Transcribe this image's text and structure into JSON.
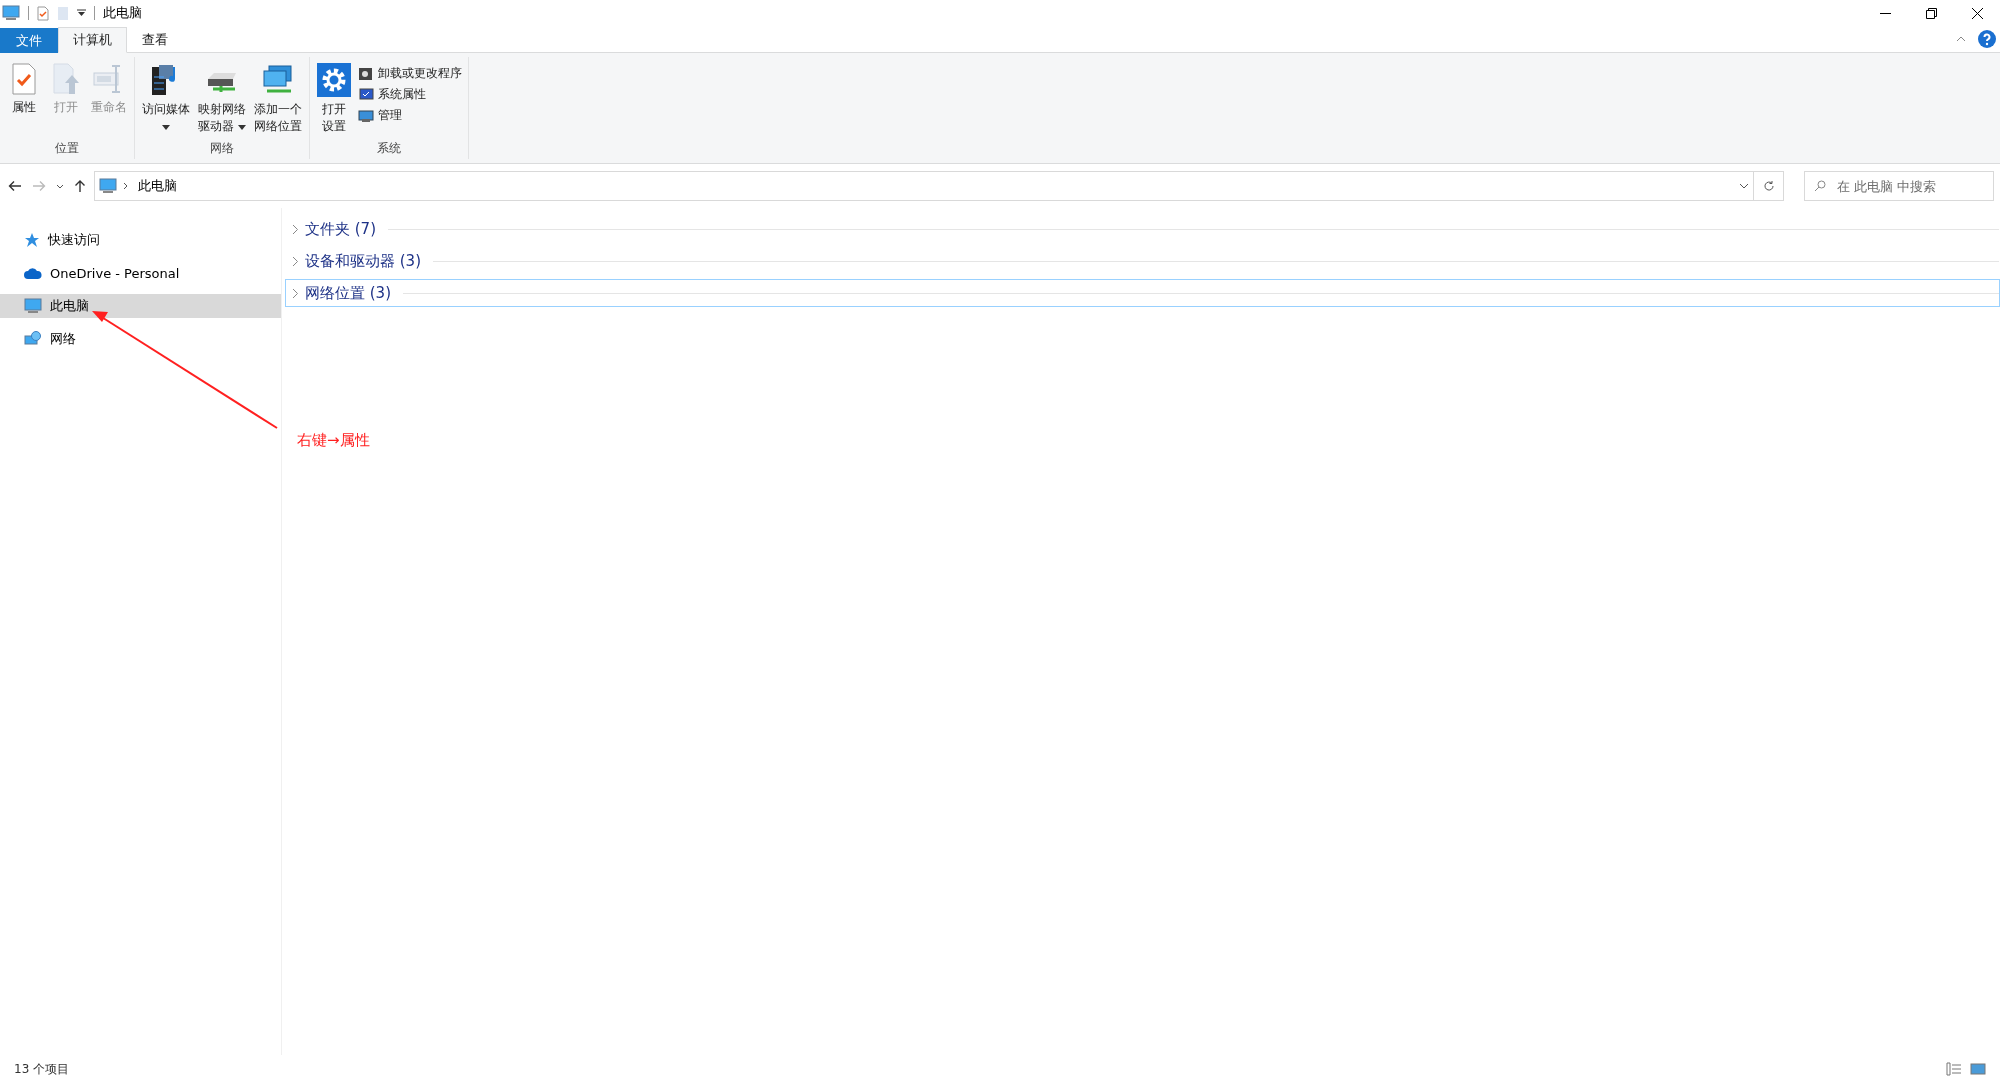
{
  "window": {
    "title": "此电脑"
  },
  "ribbon_tabs": [
    {
      "label": "文件",
      "kind": "file",
      "selected": false
    },
    {
      "label": "计算机",
      "kind": "tab",
      "selected": true
    },
    {
      "label": "查看",
      "kind": "tab",
      "selected": false
    }
  ],
  "ribbon_groups": [
    {
      "label": "位置",
      "buttons": [
        {
          "kind": "properties",
          "lines": [
            "属性"
          ],
          "disabled": false,
          "dropdown": false
        },
        {
          "kind": "open",
          "lines": [
            "打开"
          ],
          "disabled": true,
          "dropdown": false
        },
        {
          "kind": "rename",
          "lines": [
            "重命名"
          ],
          "disabled": true,
          "dropdown": false
        }
      ]
    },
    {
      "label": "网络",
      "buttons": [
        {
          "kind": "media",
          "lines": [
            "访问媒体"
          ],
          "disabled": false,
          "dropdown": true
        },
        {
          "kind": "drive",
          "lines": [
            "映射网络",
            "驱动器"
          ],
          "disabled": false,
          "dropdown": true
        },
        {
          "kind": "netloc",
          "lines": [
            "添加一个",
            "网络位置"
          ],
          "disabled": false,
          "dropdown": false
        }
      ]
    },
    {
      "label": "系统",
      "buttons": [
        {
          "kind": "settings",
          "lines": [
            "打开",
            "设置"
          ],
          "disabled": false,
          "dropdown": false
        }
      ],
      "small_buttons": [
        {
          "kind": "uninstall",
          "label": "卸载或更改程序"
        },
        {
          "kind": "sysprops",
          "label": "系统属性"
        },
        {
          "kind": "manage",
          "label": "管理"
        }
      ]
    }
  ],
  "address": {
    "path": "此电脑"
  },
  "search": {
    "placeholder": "在 此电脑 中搜索"
  },
  "sidebar": {
    "items": [
      {
        "kind": "star",
        "label": "快速访问",
        "selected": false
      },
      {
        "kind": "cloud",
        "label": "OneDrive - Personal",
        "selected": false
      },
      {
        "kind": "pc",
        "label": "此电脑",
        "selected": true
      },
      {
        "kind": "network",
        "label": "网络",
        "selected": false
      }
    ]
  },
  "groups": [
    {
      "label": "文件夹 (7)",
      "expanded": false,
      "selected": false
    },
    {
      "label": "设备和驱动器 (3)",
      "expanded": false,
      "selected": false
    },
    {
      "label": "网络位置 (3)",
      "expanded": false,
      "selected": true
    }
  ],
  "annotation": {
    "text": "右键→属性"
  },
  "status_bar": {
    "count": "13 个项目"
  }
}
